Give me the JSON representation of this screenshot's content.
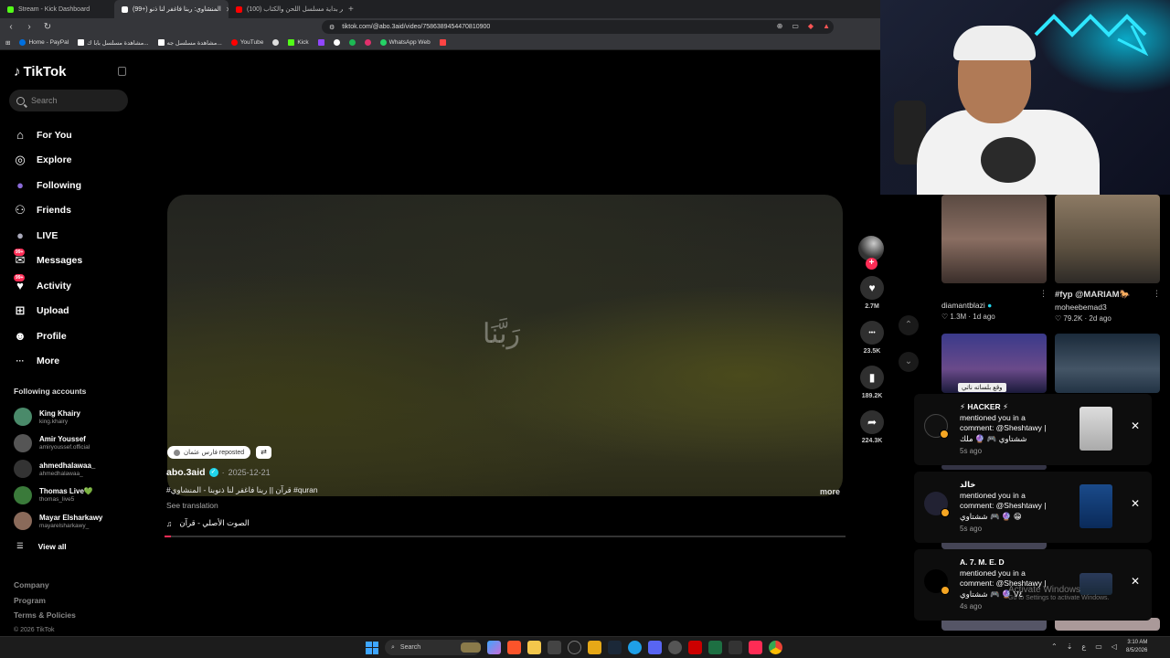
{
  "browser": {
    "tabs": [
      {
        "label": "Stream - Kick Dashboard",
        "color": "#53fc18"
      },
      {
        "label": "(99+) المنشاوي: ربنا فاغفر لنا ذنو",
        "color": "#ffffff"
      },
      {
        "label": "(100) تتر بداية مسلسل اللحن والكتاب",
        "color": "#ff0000"
      }
    ],
    "new_tab": "+",
    "url": "tiktok.com/@abo.3aid/video/7586389454470810900",
    "bookmarks": [
      {
        "label": "Home - PayPal",
        "color": "#0070e0"
      },
      {
        "label": "مشاهدة مسلسل بابا ك...",
        "color": "#ffffff"
      },
      {
        "label": "مشاهدة مسلسل جه...",
        "color": "#ffffff"
      },
      {
        "label": "YouTube",
        "color": "#ff0000"
      },
      {
        "label": "",
        "color": "#dddddd"
      },
      {
        "label": "Kick",
        "color": "#53fc18"
      },
      {
        "label": "",
        "color": "#9146ff"
      },
      {
        "label": "",
        "color": "#ffffff"
      },
      {
        "label": "",
        "color": "#1db954"
      },
      {
        "label": "",
        "color": "#e1306c"
      },
      {
        "label": "WhatsApp Web",
        "color": "#25d366"
      }
    ]
  },
  "tiktok": {
    "logo": "TikTok",
    "search_placeholder": "Search",
    "nav": [
      {
        "label": "For You",
        "icon": "home-icon",
        "glyph": "⌂"
      },
      {
        "label": "Explore",
        "icon": "compass-icon",
        "glyph": "◎"
      },
      {
        "label": "Following",
        "icon": "following-icon",
        "glyph": "●"
      },
      {
        "label": "Friends",
        "icon": "friends-icon",
        "glyph": "⚇"
      },
      {
        "label": "LIVE",
        "icon": "live-icon",
        "glyph": "●"
      },
      {
        "label": "Messages",
        "icon": "messages-icon",
        "glyph": "✉",
        "badge": "99+"
      },
      {
        "label": "Activity",
        "icon": "activity-icon",
        "glyph": "♥",
        "badge": "99+"
      },
      {
        "label": "Upload",
        "icon": "upload-icon",
        "glyph": "⊞"
      },
      {
        "label": "Profile",
        "icon": "profile-icon",
        "glyph": "☻"
      },
      {
        "label": "More",
        "icon": "more-icon",
        "glyph": "···"
      }
    ],
    "following_title": "Following accounts",
    "accounts": [
      {
        "name": "King Khairy",
        "handle": "king.khairy",
        "color": "#4a8a6a"
      },
      {
        "name": "Amir Youssef",
        "handle": "amiryoussef.official",
        "color": "#444444"
      },
      {
        "name": "ahmedhalawaa_",
        "handle": "ahmedhalawaa_",
        "color": "#333333"
      },
      {
        "name": "Thomas Live💚",
        "handle": "thomas_live5",
        "color": "#3a7a3a"
      },
      {
        "name": "Mayar Elsharkawy",
        "handle": "mayarelsharkawy_",
        "color": "#8a6a5a"
      }
    ],
    "view_all": "View all",
    "footer": [
      "Company",
      "Program",
      "Terms & Policies"
    ],
    "copyright": "© 2026 TikTok"
  },
  "video": {
    "overlay_text": "رَبَّنَا",
    "repost_text": "فارس عثمان reposted",
    "author": "abo.3aid",
    "date": "2025-12-21",
    "description": "#قرآن || ربنا فاغفر لنا ذنوبنا - المنشاوي #quran",
    "see_translation": "See translation",
    "more": "more",
    "music": "الصوت الأصلي - قرآن",
    "progress": 0.01,
    "accent": "#fe2c55",
    "actions": [
      {
        "name": "like",
        "icon": "heart-icon",
        "glyph": "♥",
        "count": "2.7M"
      },
      {
        "name": "comment",
        "icon": "comment-icon",
        "glyph": "•••",
        "count": "23.5K"
      },
      {
        "name": "save",
        "icon": "bookmark-icon",
        "glyph": "▮",
        "count": "189.2K"
      },
      {
        "name": "share",
        "icon": "share-icon",
        "glyph": "➦",
        "count": "224.3K"
      }
    ]
  },
  "recommendations": [
    {
      "user": "diamantblazi",
      "caption": "",
      "stats": "♡ 1.3M · 1d ago"
    },
    {
      "user": "moheebemad3",
      "caption": "#fyp @MARIAM🐎",
      "stats": "♡ 79.2K · 2d ago"
    }
  ],
  "rec_thumb_text": "وقع بلساته ناتي",
  "notifications": [
    {
      "title": "⚡ HACKER ⚡",
      "text": "mentioned you in a comment: @Sheshtawy | ششتاوي 🎮 🔮 ملك",
      "time": "5s ago"
    },
    {
      "title": "خالد",
      "text": "mentioned you in a comment: @Sheshtawy | ششتاوي 🎮 🔮 😁",
      "time": "5s ago"
    },
    {
      "title": "A. 7. M. E. D",
      "text": "mentioned you in a comment: @Sheshtawy | ششتاوي 🎮 🔮 V٤",
      "time": "4s ago"
    }
  ],
  "watermark": {
    "title": "Activate Windows",
    "subtitle": "Go to Settings to activate Windows."
  },
  "taskbar": {
    "search": "Search",
    "time": "3:10 AM",
    "date": "8/5/2026"
  }
}
